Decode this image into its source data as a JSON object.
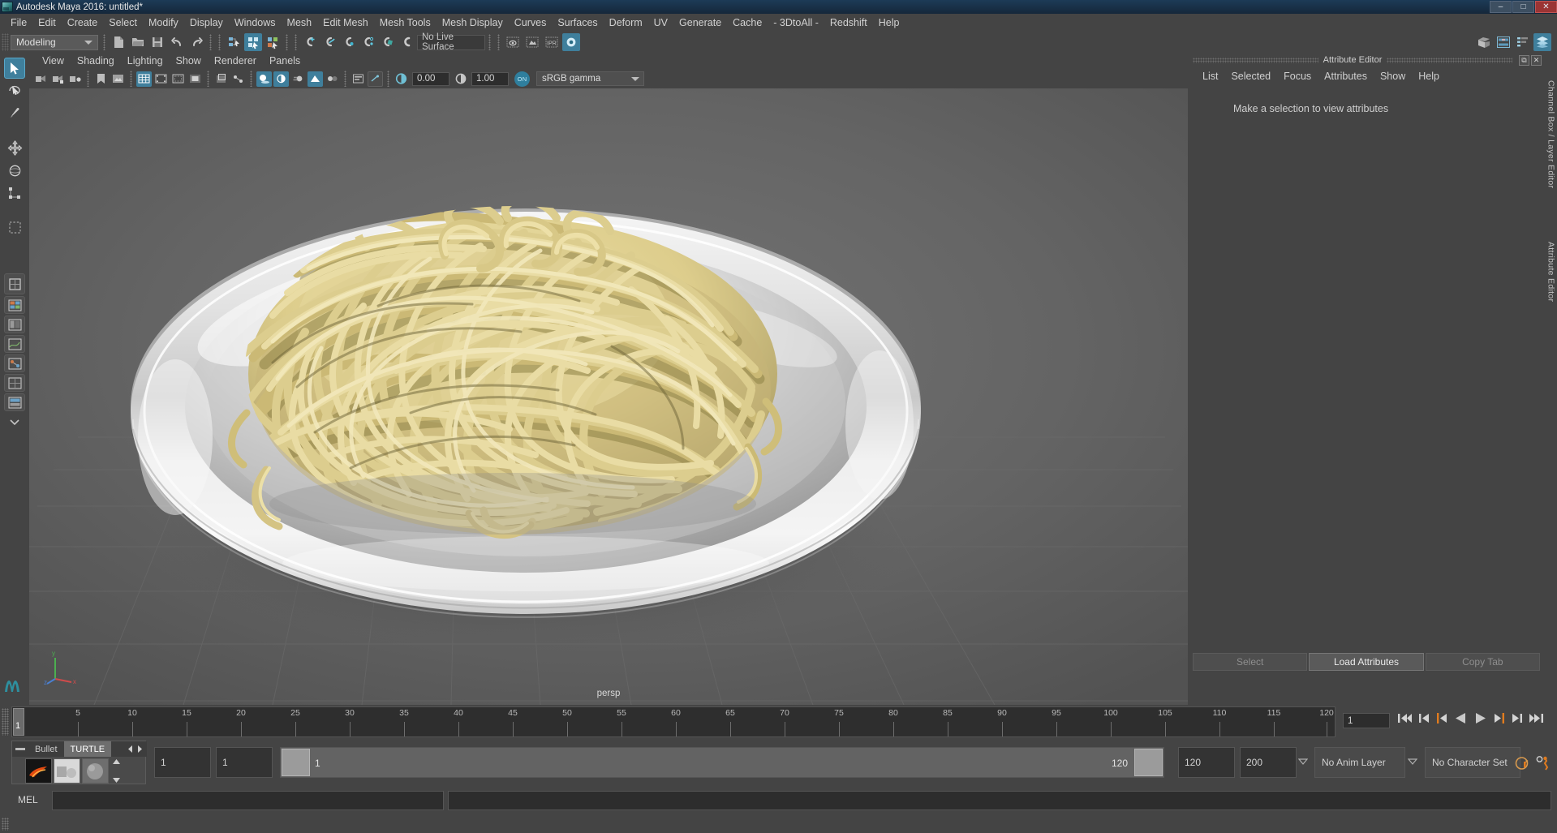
{
  "window": {
    "title": "Autodesk Maya 2016: untitled*",
    "buttons": {
      "minimize": "–",
      "maximize": "□",
      "close": "✕"
    }
  },
  "menubar": {
    "items": [
      "File",
      "Edit",
      "Create",
      "Select",
      "Modify",
      "Display",
      "Windows",
      "Mesh",
      "Edit Mesh",
      "Mesh Tools",
      "Mesh Display",
      "Curves",
      "Surfaces",
      "Deform",
      "UV",
      "Generate",
      "Cache",
      "- 3DtoAll -",
      "Redshift",
      "Help"
    ]
  },
  "statusline": {
    "menuset": "Modeling",
    "live_surface": "No Live Surface",
    "icons": [
      "new-scene-icon",
      "open-scene-icon",
      "save-scene-icon",
      "undo-icon",
      "redo-icon",
      "select-by-hierarchy-icon",
      "select-by-object-icon",
      "select-by-component-icon",
      "snap-to-grid-icon",
      "snap-to-curve-icon",
      "snap-to-point-icon",
      "snap-to-projected-center-icon",
      "snap-to-view-plane-icon",
      "make-live-icon",
      "show-hide-render-view-icon",
      "render-current-frame-icon",
      "ipr-render-icon",
      "render-settings-icon"
    ],
    "right_icons": [
      "toggle-sidebar-icon",
      "attribute-editor-icon",
      "channel-box-icon",
      "layer-editor-icon"
    ]
  },
  "toolbox": {
    "tools": [
      "select-tool",
      "lasso-select-tool",
      "paint-select-tool",
      "move-tool",
      "rotate-tool",
      "scale-tool",
      "last-tool-used",
      "quick-layout-single-perspective",
      "quick-layout-four-view",
      "quick-layout-persp-outliner",
      "quick-layout-persp-graph",
      "quick-layout-hypershade",
      "quick-layout-persp-uv",
      "quick-layout-extra",
      "quick-layout-more"
    ],
    "logo": "maya-logo"
  },
  "viewport": {
    "panel_menus": [
      "View",
      "Shading",
      "Lighting",
      "Show",
      "Renderer",
      "Panels"
    ],
    "exposure": "0.00",
    "gamma": "1.00",
    "color_management": "sRGB gamma",
    "color_management_enabled": "ON",
    "camera_label": "persp",
    "axis": {
      "x": "x",
      "y": "y",
      "z": "z"
    },
    "toolbar_icons": [
      "select-camera-icon",
      "lock-camera-icon",
      "camera-attributes-icon",
      "bookmarks-icon",
      "image-plane-icon",
      "two-d-pan-zoom-icon",
      "grid-toggle-icon",
      "film-gate-icon",
      "resolution-gate-icon",
      "gate-mask-icon",
      "xray-toggle-icon",
      "xray-joints-icon",
      "shadows-icon",
      "screen-space-ao-icon",
      "motion-blur-icon",
      "multisample-icon",
      "depth-of-field-icon",
      "viewport-settings-icon",
      "isolate-select-icon",
      "exposure-icon",
      "gamma-icon"
    ],
    "scene": {
      "description": "A bowl-shaped white ceramic plate holding a large mound of tangled spaghetti noodles, rendered on a grey ground plane with grid",
      "plate_color": "#d9d9d9",
      "noodle_color": "#ddcd8f",
      "noodle_shadow": "#8e8245",
      "ground_color": "#636363"
    }
  },
  "attribute_editor": {
    "title": "Attribute Editor",
    "window_buttons": [
      "undock-icon",
      "close-icon"
    ],
    "menus": [
      "List",
      "Selected",
      "Focus",
      "Attributes",
      "Show",
      "Help"
    ],
    "message": "Make a selection to view attributes",
    "buttons": [
      {
        "label": "Select",
        "state": "disabled"
      },
      {
        "label": "Load Attributes",
        "state": "active"
      },
      {
        "label": "Copy Tab",
        "state": "disabled"
      }
    ]
  },
  "right_tabs": [
    "Channel Box / Layer Editor",
    "Attribute Editor"
  ],
  "timeline": {
    "current_frame": "1",
    "frame_field": "1",
    "ticks": [
      5,
      10,
      15,
      20,
      25,
      30,
      35,
      40,
      45,
      50,
      55,
      60,
      65,
      70,
      75,
      80,
      85,
      90,
      95,
      100,
      105,
      110,
      115,
      120
    ],
    "start": 1,
    "end": 120,
    "playback_buttons": [
      "go-to-start-icon",
      "step-back-frame-icon",
      "step-back-key-icon",
      "play-backwards-icon",
      "play-forwards-icon",
      "step-forward-key-icon",
      "step-forward-frame-icon",
      "go-to-end-icon"
    ]
  },
  "range_slider": {
    "anim_start": "1",
    "range_start": "1",
    "range_bar_start": "1",
    "range_bar_end": "120",
    "range_end": "120",
    "anim_end": "200",
    "anim_layer": "No Anim Layer",
    "character_set": "No Character Set",
    "icons": [
      "auto-keyframe-icon",
      "animation-preferences-icon"
    ]
  },
  "shelf_popup": {
    "tabs": [
      "Bullet",
      "TURTLE"
    ],
    "active_tab": "TURTLE",
    "nav": [
      "prev-shelf-arrow",
      "next-shelf-arrow"
    ],
    "icons": [
      "turtle-render-icon",
      "turtle-bake-icon",
      "turtle-material-icon"
    ]
  },
  "command_line": {
    "language": "MEL",
    "input_value": "",
    "output_value": ""
  },
  "colors": {
    "bg": "#444444",
    "accent_blue": "#3f7f9c",
    "accent_orange": "#e07b1f",
    "title_gradient_top": "#1d3b57",
    "field_bg": "#2d2d2d"
  }
}
